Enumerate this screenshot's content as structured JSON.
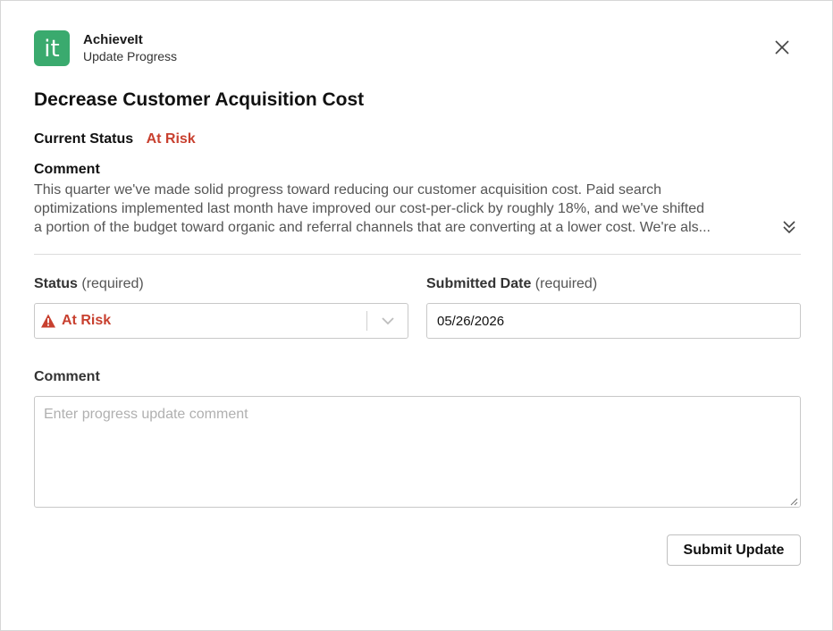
{
  "app": {
    "name": "AchieveIt",
    "subtitle": "Update Progress",
    "logo_text": "it",
    "brand_color": "#3aaa6e"
  },
  "dialog": {
    "close_icon": "close-icon"
  },
  "plan_item": {
    "title": "Decrease Customer Acquisition Cost"
  },
  "current_status": {
    "label": "Current Status",
    "value": "At Risk",
    "color": "#c8402f"
  },
  "previous_comment": {
    "label": "Comment",
    "lines": [
      "This quarter we've made solid progress toward reducing our customer acquisition cost. Paid search",
      "optimizations implemented last month have improved our cost-per-click by roughly 18%, and we've shifted",
      "a portion of the budget toward organic and referral channels that are converting at a lower cost. We're als..."
    ],
    "expand_icon": "double-chevron-down-icon"
  },
  "form": {
    "status": {
      "label": "Status",
      "required_text": "(required)",
      "selected_value": "At Risk",
      "icon": "warning-triangle-icon",
      "dropdown_icon": "chevron-down-icon"
    },
    "submitted_date": {
      "label": "Submitted Date",
      "required_text": "(required)",
      "value": "05/26/2026"
    },
    "comment": {
      "label": "Comment",
      "value": "",
      "placeholder": "Enter progress update comment"
    },
    "submit_label": "Submit Update"
  }
}
